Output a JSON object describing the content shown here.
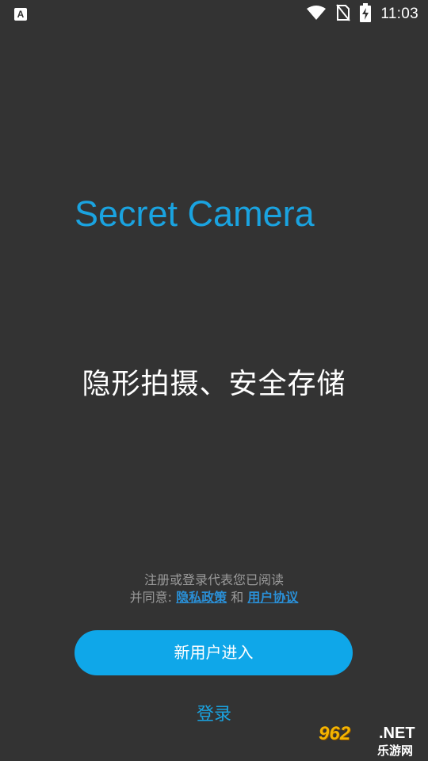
{
  "status_bar": {
    "app_icon_letter": "A",
    "time": "11:03",
    "icons": [
      "wifi-icon",
      "no-sim-icon",
      "battery-charging-icon"
    ]
  },
  "brand": {
    "title": "Secret Camera",
    "color": "#1aa3e0"
  },
  "slogan": "隐形拍摄、安全存储",
  "agreement": {
    "line1": "注册或登录代表您已阅读",
    "line2_prefix": "并同意:",
    "privacy_link": "隐私政策",
    "conjunction": "和",
    "terms_link": "用户协议"
  },
  "actions": {
    "new_user_label": "新用户进入",
    "login_label": "登录"
  },
  "watermark": {
    "number": "962",
    "suffix": ".NET",
    "site_cn": "乐游网"
  },
  "colors": {
    "background": "#333333",
    "accent": "#0fa7e9",
    "link": "#2a8fd6"
  }
}
